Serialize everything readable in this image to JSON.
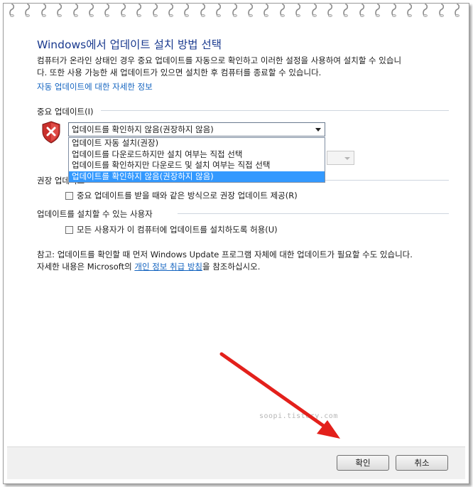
{
  "dialog": {
    "title": "Windows에서 업데이트 설치 방법 선택",
    "intro_line1": "컴퓨터가 온라인 상태인 경우 중요 업데이트를 자동으로 확인하고 이러한 설정을 사용하여 설치할 수 있습니",
    "intro_line2": "다. 또한 사용 가능한 새 업데이트가 있으면 설치한 후 컴퓨터를 종료할 수 있습니다.",
    "auto_update_link": "자동 업데이트에 대한 자세한 정보"
  },
  "important_updates": {
    "heading": "중요 업데이트(I)",
    "selected_value": "업데이트를 확인하지 않음(권장하지 않음)",
    "options": [
      "업데이트 자동 설치(권장)",
      "업데이트를 다운로드하지만 설치 여부는 직접 선택",
      "업데이트를 확인하지만 다운로드 및 설치 여부는 직접 선택",
      "업데이트를 확인하지 않음(권장하지 않음)"
    ]
  },
  "recommended_updates": {
    "heading": "권장 업데이트",
    "checkbox_label": "중요 업데이트를 받을 때와 같은 방식으로 권장 업데이트 제공(R)",
    "checked": false
  },
  "who_can_install": {
    "heading": "업데이트를 설치할 수 있는 사용자",
    "checkbox_label": "모든 사용자가 이 컴퓨터에 업데이트를 설치하도록 허용(U)",
    "checked": false
  },
  "note": {
    "line1": "참고: 업데이트를 확인할 때 먼저 Windows Update 프로그램 자체에 대한 업데이트가 필요할 수도 있습니다.",
    "line2_prefix": "자세한 내용은 Microsoft의 ",
    "line2_link": "개인 정보 취급 방침",
    "line2_suffix": "을 참조하십시오."
  },
  "watermark": "soopi.tistory.com",
  "buttons": {
    "ok": "확인",
    "cancel": "취소"
  },
  "colors": {
    "title": "#1a3a8f",
    "link": "#1565c0",
    "selection": "#3399ff",
    "annotation_arrow": "#e3201b"
  },
  "icons": {
    "shield": "shield-error-icon",
    "binder_rings": "binder-ring-icon"
  }
}
